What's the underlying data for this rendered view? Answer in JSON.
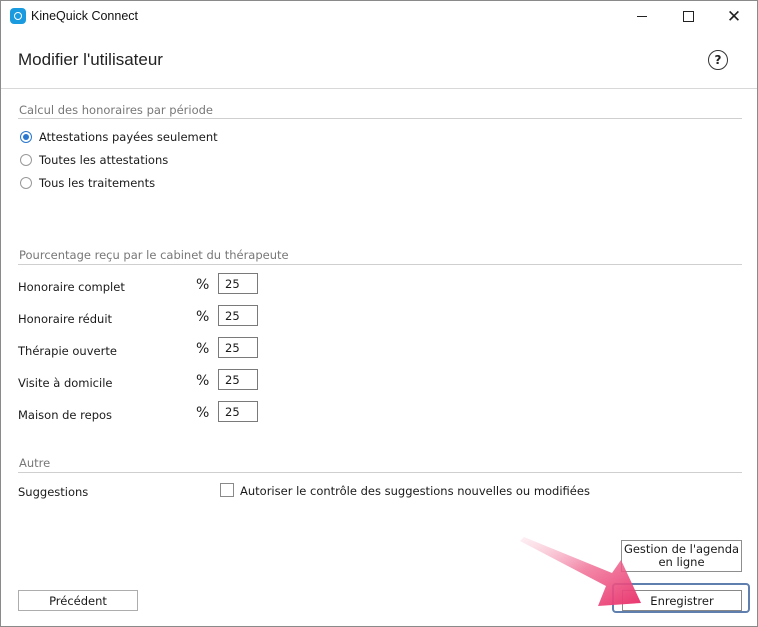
{
  "window": {
    "app_title": "KineQuick Connect",
    "controls": {
      "minimize": "minimize",
      "maximize": "maximize",
      "close": "✕"
    }
  },
  "header": {
    "title": "Modifier l'utilisateur",
    "help": "?"
  },
  "fees_section": {
    "title": "Calcul des honoraires par période",
    "options": [
      {
        "label": "Attestations payées seulement",
        "selected": true
      },
      {
        "label": "Toutes les attestations",
        "selected": false
      },
      {
        "label": "Tous les traitements",
        "selected": false
      }
    ]
  },
  "percentage_section": {
    "title": "Pourcentage reçu par le cabinet du thérapeute",
    "unit": "%",
    "rows": [
      {
        "label": "Honoraire complet",
        "value": "25"
      },
      {
        "label": "Honoraire réduit",
        "value": "25"
      },
      {
        "label": "Thérapie ouverte",
        "value": "25"
      },
      {
        "label": "Visite à domicile",
        "value": "25"
      },
      {
        "label": "Maison de repos",
        "value": "25"
      }
    ]
  },
  "other_section": {
    "title": "Autre",
    "suggestions_label": "Suggestions",
    "checkbox_label": "Autoriser le contrôle des suggestions nouvelles ou modifiées",
    "checkbox_checked": false
  },
  "footer": {
    "previous": "Précédent",
    "agenda_line1": "Gestion de l'agenda",
    "agenda_line2": "en ligne",
    "save": "Enregistrer"
  },
  "colors": {
    "accent": "#2a78d0",
    "highlight_arrow": "#e8336d"
  }
}
